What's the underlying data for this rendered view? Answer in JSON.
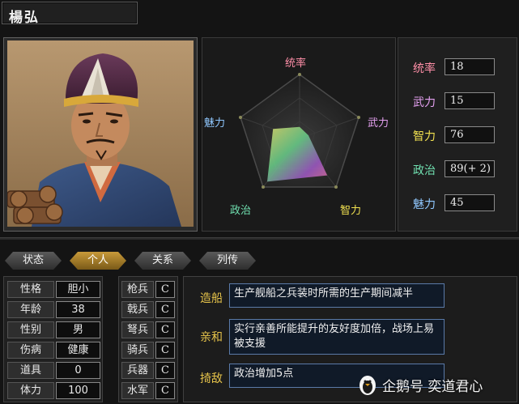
{
  "officer": {
    "name": "楊弘"
  },
  "radar": {
    "labels": {
      "top": "统率",
      "right": "武力",
      "bottom_right": "智力",
      "bottom_left": "政治",
      "left": "魅力"
    },
    "stat_levels": {
      "leadership": 0.18,
      "war": 0.15,
      "intelligence": 0.76,
      "politics": 0.89,
      "charm": 0.45
    }
  },
  "stats": [
    {
      "label": "统率",
      "value": "18",
      "color": "#ff8fa8"
    },
    {
      "label": "武力",
      "value": "15",
      "color": "#e4a0f0"
    },
    {
      "label": "智力",
      "value": "76",
      "color": "#f0e050"
    },
    {
      "label": "政治",
      "value": "89(+ 2)",
      "color": "#70e0b0"
    },
    {
      "label": "魅力",
      "value": "45",
      "color": "#90c8ff"
    }
  ],
  "tabs": [
    {
      "label": "状态",
      "active": false
    },
    {
      "label": "个人",
      "active": true
    },
    {
      "label": "关系",
      "active": false
    },
    {
      "label": "列传",
      "active": false
    }
  ],
  "personal": [
    {
      "label": "性格",
      "value": "胆小"
    },
    {
      "label": "年龄",
      "value": "38"
    },
    {
      "label": "性别",
      "value": "男"
    },
    {
      "label": "伤病",
      "value": "健康"
    },
    {
      "label": "道具",
      "value": "0"
    },
    {
      "label": "体力",
      "value": "100"
    }
  ],
  "aptitude": [
    {
      "label": "枪兵",
      "value": "C"
    },
    {
      "label": "戟兵",
      "value": "C"
    },
    {
      "label": "弩兵",
      "value": "C"
    },
    {
      "label": "骑兵",
      "value": "C"
    },
    {
      "label": "兵器",
      "value": "C"
    },
    {
      "label": "水军",
      "value": "C"
    }
  ],
  "skills": [
    {
      "name": "造船",
      "desc": "生产舰船之兵装时所需的生产期间减半"
    },
    {
      "name": "亲和",
      "desc": "实行亲善所能提升的友好度加倍，战场上易被支援"
    },
    {
      "name": "掎敌",
      "desc": "政治增加5点"
    }
  ],
  "watermark": {
    "text": "企鹅号 奕道君心",
    "icon": "penguin-icon"
  }
}
